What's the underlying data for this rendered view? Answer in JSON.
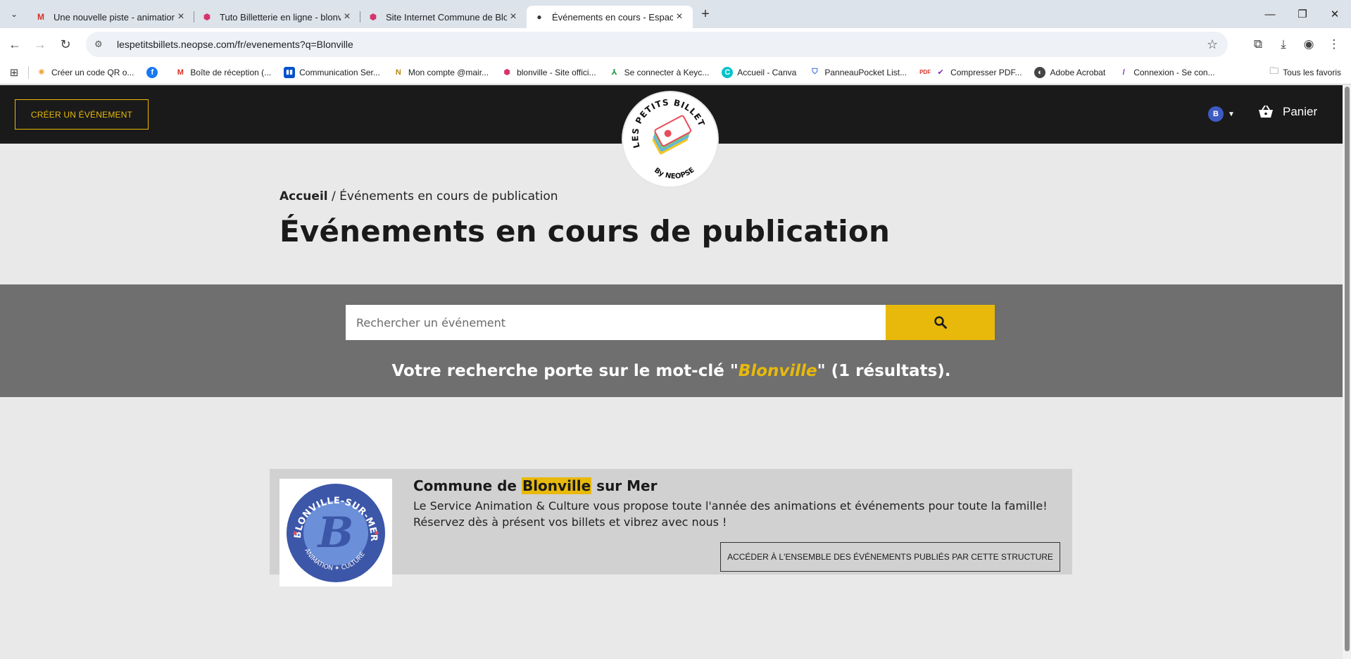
{
  "browser": {
    "tabs": [
      {
        "title": "Une nouvelle piste - animation",
        "icon": "gmail-icon",
        "active": false
      },
      {
        "title": "Tuto Billetterie en ligne - blonv",
        "icon": "site-hex-icon",
        "active": false
      },
      {
        "title": "Site Internet Commune de Blon",
        "icon": "site-hex-icon",
        "active": false
      },
      {
        "title": "Événements en cours - Espace c",
        "icon": "dot-icon",
        "active": true
      }
    ],
    "url": "lespetitsbillets.neopse.com/fr/evenements?q=Blonville",
    "bookmarks": [
      {
        "label": "Créer un code QR o...",
        "icon": "qr-sun-icon",
        "color": "#f2a23a"
      },
      {
        "label": "",
        "icon": "facebook-icon",
        "color": "#1877f2"
      },
      {
        "label": "Boîte de réception (...",
        "icon": "gmail-icon",
        "color": "#d93025"
      },
      {
        "label": "Communication Ser...",
        "icon": "trello-icon",
        "color": "#0052cc"
      },
      {
        "label": "Mon compte @mair...",
        "icon": "n-icon",
        "color": "#b8860b"
      },
      {
        "label": "blonville - Site offici...",
        "icon": "site-hex-icon",
        "color": "#d6336c"
      },
      {
        "label": "Se connecter à Keyc...",
        "icon": "keycloak-icon",
        "color": "#2e9c4a"
      },
      {
        "label": "Accueil - Canva",
        "icon": "canva-icon",
        "color": "#00c4cc"
      },
      {
        "label": "PanneauPocket List...",
        "icon": "panneaupocket-icon",
        "color": "#3a6fd8"
      },
      {
        "label": "Compresser PDF...",
        "icon": "pdf24-icon",
        "color": "#d93025"
      },
      {
        "label": "Adobe Acrobat",
        "icon": "acrobat-icon",
        "color": "#444444"
      },
      {
        "label": "Connexion - Se con...",
        "icon": "slash-icon",
        "color": "#7b2cbf"
      }
    ],
    "all_bookmarks": "Tous les favoris"
  },
  "header": {
    "create_button": "CRÉER UN ÉVÉNEMENT",
    "logo_text_top": "LES PETITS BILLETS",
    "logo_text_bottom": "By NEOPSE",
    "cart_label": "Panier",
    "accent": "#e8b90a"
  },
  "breadcrumb": {
    "home": "Accueil",
    "separator": " / ",
    "current": "Événements en cours de publication"
  },
  "page_title": "Événements en cours de publication",
  "search": {
    "placeholder": "Rechercher un événement",
    "result_prefix": "Votre recherche porte sur le mot-clé \"",
    "keyword": "Blonville",
    "result_suffix": "\" (1 résultats)."
  },
  "organization": {
    "name_before": "Commune de ",
    "name_highlight": "Blonville",
    "name_after": " sur Mer",
    "description": "Le Service Animation & Culture vous propose toute l'année des animations et événements pour toute la famille! Réservez dès à présent vos billets et vibrez avec nous !",
    "button": "ACCÉDER À L'ENSEMBLE DES ÉVÉNEMENTS PUBLIÉS PAR CETTE STRUCTURE",
    "logo_top": "BLONVILLE-SUR-MER",
    "logo_letter": "B",
    "logo_bottom": "ANIMATION ✶ CULTURE"
  }
}
